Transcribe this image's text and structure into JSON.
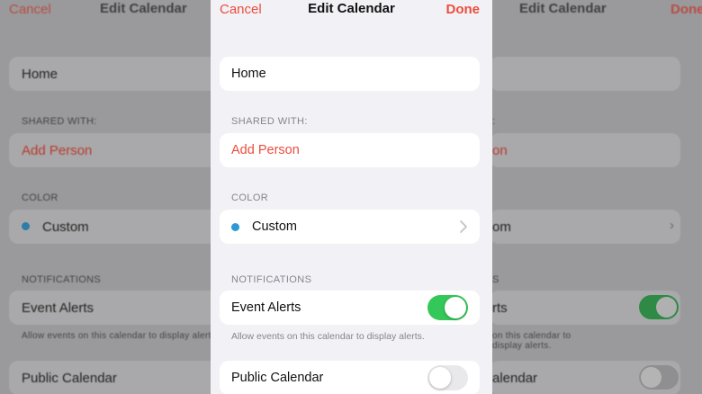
{
  "nav": {
    "cancel_label": "Cancel",
    "title": "Edit Calendar",
    "done_label": "Done"
  },
  "calendar_name": "Home",
  "shared_with": {
    "header": "SHARED WITH:",
    "add_person_label": "Add Person"
  },
  "color": {
    "header": "COLOR",
    "value_label": "Custom",
    "dot_color": "#2b9ad6"
  },
  "notifications": {
    "header": "NOTIFICATIONS",
    "event_alerts_label": "Event Alerts",
    "event_alerts_on": true,
    "footnote": "Allow events on this calendar to display alerts."
  },
  "public_calendar": {
    "label": "Public Calendar",
    "on": false
  },
  "colors": {
    "accent": "#eb4d3d",
    "toggle_on": "#34c759",
    "background": "#f2f1f6"
  }
}
